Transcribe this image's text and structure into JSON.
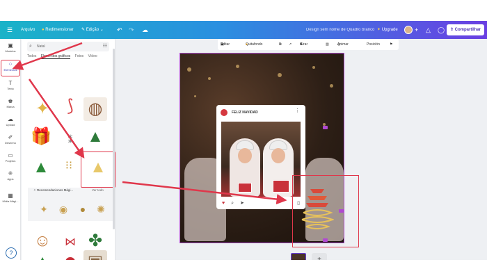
{
  "topbar": {
    "menu_icon": "hamburger-icon",
    "file_label": "Arquivo",
    "resize_label": "Redimensionar",
    "edit_label": "Edição",
    "design_name": "Design sem nome de Quadro branco",
    "upgrade_label": "Upgrade",
    "share_label": "Compartilhar"
  },
  "rail": {
    "items": [
      {
        "label": "Modelos",
        "icon": "template-icon"
      },
      {
        "label": "Elementos",
        "icon": "elements-icon"
      },
      {
        "label": "Texto",
        "icon": "text-icon"
      },
      {
        "label": "Marca",
        "icon": "brand-icon"
      },
      {
        "label": "Upload",
        "icon": "upload-icon"
      },
      {
        "label": "Desenho",
        "icon": "draw-icon"
      },
      {
        "label": "Projetos",
        "icon": "folder-icon"
      },
      {
        "label": "Apps",
        "icon": "apps-icon"
      },
      {
        "label": "Mídia Mági...",
        "icon": "magic-media-icon"
      }
    ]
  },
  "panel": {
    "search_value": "Natal",
    "tabs": [
      "Todos",
      "Elementos gráficos",
      "Fotos",
      "Vídeo"
    ],
    "recommendations_title": "Recomendaciones Mági...",
    "see_all": "Ver todo"
  },
  "ctxbar": {
    "edit": "Editar",
    "crop": "Quitafondo",
    "flip": "Girar",
    "animate": "Animar",
    "position": "Posición"
  },
  "canvas": {
    "post_title": "FELIZ NAVIDAD"
  },
  "colors": {
    "accent": "#6a3fe2",
    "highlight": "#e0374b",
    "selection": "#b04ad0"
  }
}
